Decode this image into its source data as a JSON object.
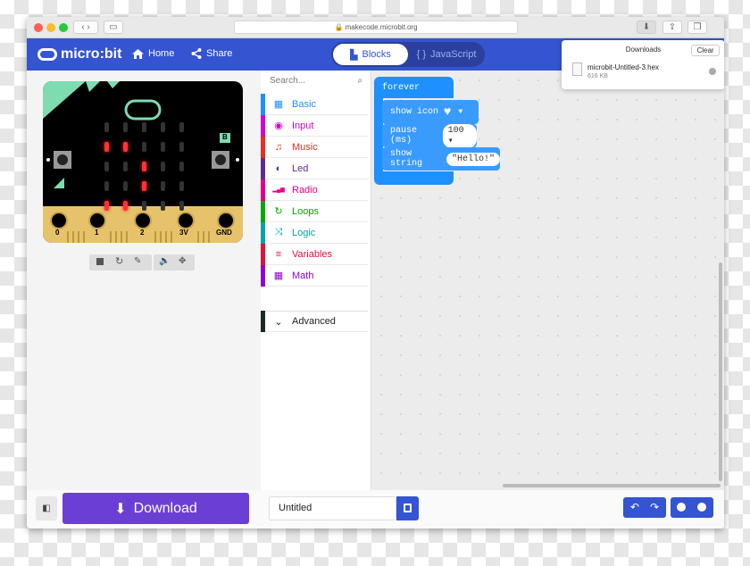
{
  "browser": {
    "url": "makecode.microbit.org",
    "downloads_title": "Downloads",
    "clear_label": "Clear",
    "download_file": "microbit-Untitled-3.hex",
    "download_size": "616 KB"
  },
  "header": {
    "logo": "micro:bit",
    "home": "Home",
    "share": "Share",
    "blocks": "Blocks",
    "javascript": "JavaScript"
  },
  "simulator": {
    "pins": [
      "0",
      "1",
      "2",
      "3V",
      "GND"
    ],
    "button_b": "B"
  },
  "toolbox": {
    "search_placeholder": "Search...",
    "categories": [
      {
        "label": "Basic",
        "color": "#1e90ff",
        "icon": "grid-icon"
      },
      {
        "label": "Input",
        "color": "#d400d4",
        "icon": "target-icon"
      },
      {
        "label": "Music",
        "color": "#e63022",
        "icon": "headphones-icon"
      },
      {
        "label": "Led",
        "color": "#5c2d91",
        "icon": "toggle-icon"
      },
      {
        "label": "Radio",
        "color": "#e3008c",
        "icon": "signal-icon"
      },
      {
        "label": "Loops",
        "color": "#00aa00",
        "icon": "refresh-icon"
      },
      {
        "label": "Logic",
        "color": "#00a4a6",
        "icon": "shuffle-icon"
      },
      {
        "label": "Variables",
        "color": "#dc143c",
        "icon": "lines-icon"
      },
      {
        "label": "Math",
        "color": "#9400d3",
        "icon": "calculator-icon"
      }
    ],
    "advanced": "Advanced"
  },
  "workspace": {
    "forever": "forever",
    "show_icon": "show icon",
    "pause": "pause (ms)",
    "pause_value": "100",
    "show_string": "show string",
    "string_value": "\"Hello!\""
  },
  "footer": {
    "download": "Download",
    "project_name": "Untitled"
  }
}
